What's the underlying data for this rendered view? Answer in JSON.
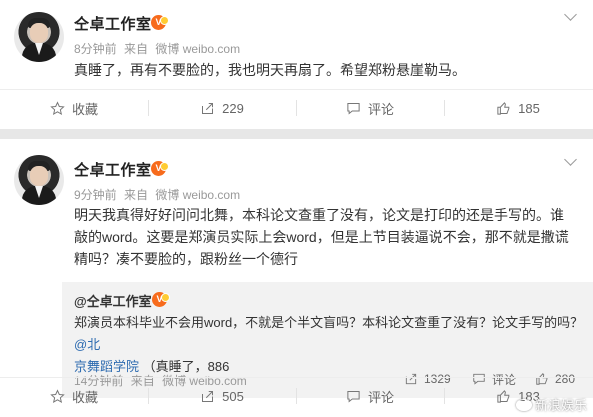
{
  "posts": [
    {
      "username": "仝卓工作室",
      "verified_badge": "V",
      "time": "8分钟前",
      "source_prefix": "来自",
      "source": "微博 weibo.com",
      "text": "真睡了，再有不要脸的，我也明天再扇了。希望郑粉悬崖勒马。",
      "actions": {
        "favorite": "收藏",
        "repost_count": "229",
        "comment": "评论",
        "like_count": "185"
      }
    },
    {
      "username": "仝卓工作室",
      "verified_badge": "V",
      "time": "9分钟前",
      "source_prefix": "来自",
      "source": "微博 weibo.com",
      "text_lines": [
        "明天我真得好好问问北舞，本科论文查重了没有，论文是打印的还是手写的。谁",
        "敲的word。这要是郑演员实际上会word，但是上节目装逼说不会，那不就是撒谎",
        "精吗？凑不要脸的，跟粉丝一个德行"
      ],
      "quote": {
        "user": "@仝卓工作室",
        "text_line1": "郑演员本科毕业不会用word，不就是个半文盲吗？本科论文查重了没有？论文手写的吗？",
        "mention_part1": "@北",
        "mention_part2": "京舞蹈学院",
        "text_line2_rest": "（真睡了，886",
        "time": "14分钟前",
        "source_prefix": "来自",
        "source": "微博 weibo.com",
        "repost_count": "1329",
        "comment": "评论",
        "like_count": "280"
      },
      "actions": {
        "favorite": "收藏",
        "repost_count": "505",
        "comment": "评论",
        "like_count": "183"
      }
    }
  ],
  "watermark": "新浪娱乐",
  "icons": [
    "star-icon",
    "repost-icon",
    "comment-icon",
    "like-icon",
    "chevron-down-icon"
  ],
  "colors": {
    "badge": "#f76b1c",
    "link": "#2d6bb0",
    "background": "#e7e7e7"
  }
}
